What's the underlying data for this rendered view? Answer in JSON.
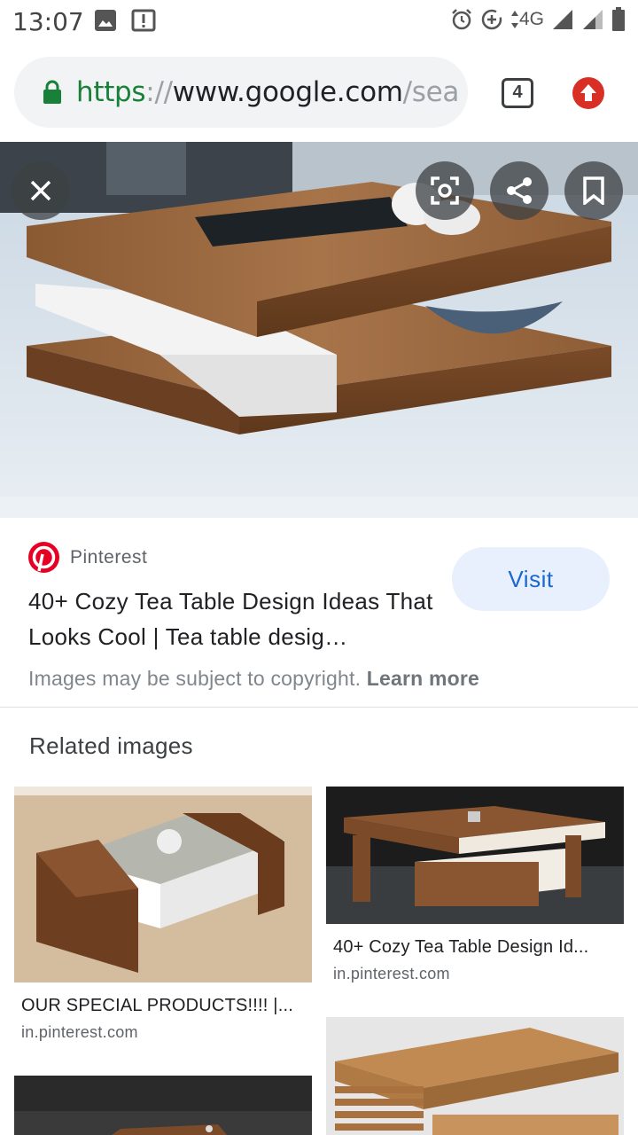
{
  "status_bar": {
    "time": "13:07",
    "network": "4G",
    "icons": [
      "image-notification-icon",
      "alert-notification-icon",
      "alarm-icon",
      "data-saver-icon",
      "signal-icon",
      "battery-icon"
    ]
  },
  "browser": {
    "url_scheme": "https",
    "url_sep": "://",
    "url_host": "www.google.com",
    "url_path": "/sea",
    "tab_count": "4",
    "secure_color": "#188038"
  },
  "result": {
    "source": "Pinterest",
    "title": "40+ Cozy Tea Table Design Ideas That Looks Cool | Tea table desig…",
    "visit_label": "Visit",
    "copyright_text": "Images may be subject to copyright.",
    "learn_more": "Learn more"
  },
  "related": {
    "heading": "Related images",
    "items": [
      {
        "caption": "OUR SPECIAL PRODUCTS!!!! |...",
        "domain": "in.pinterest.com"
      },
      {
        "caption": "40+ Cozy Tea Table Design Id...",
        "domain": "in.pinterest.com"
      }
    ]
  },
  "colors": {
    "accent_blue": "#1967d2",
    "visit_bg": "#e8f0fe",
    "pinterest_red": "#e60023",
    "update_red": "#d93025"
  }
}
